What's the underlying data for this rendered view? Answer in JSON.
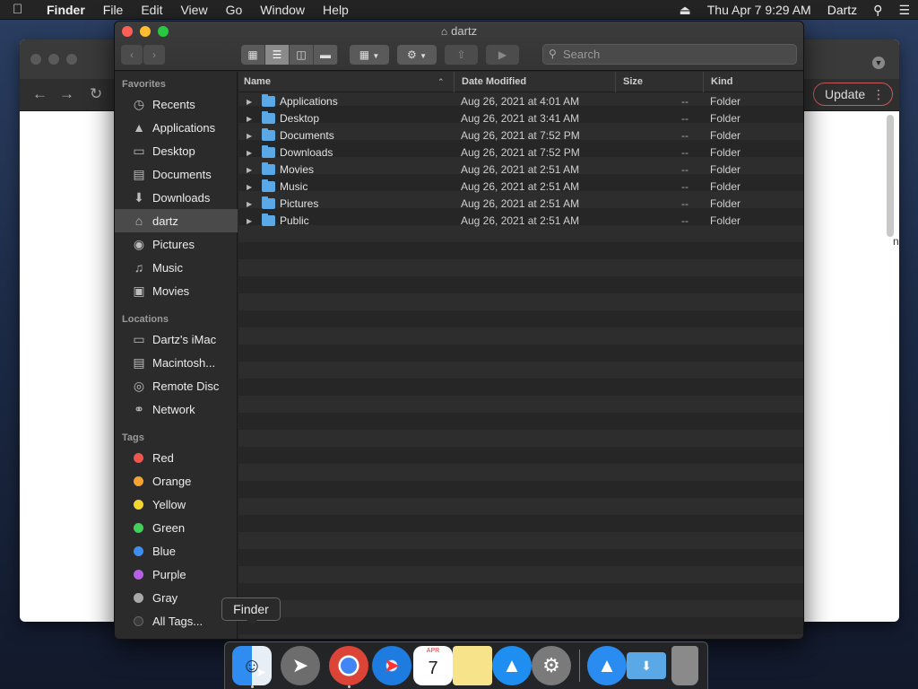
{
  "menubar": {
    "apple_icon": "apple-icon",
    "app_name": "Finder",
    "menus": [
      "File",
      "Edit",
      "View",
      "Go",
      "Window",
      "Help"
    ],
    "datetime": "Thu Apr 7  9:29 AM",
    "user": "Dartz"
  },
  "browser": {
    "update_label": "Update",
    "edge_text": "n"
  },
  "finder": {
    "title": "dartz",
    "search_placeholder": "Search",
    "sidebar": {
      "favorites_heading": "Favorites",
      "favorites": [
        {
          "label": "Recents",
          "icon": "clock-icon"
        },
        {
          "label": "Applications",
          "icon": "applications-icon"
        },
        {
          "label": "Desktop",
          "icon": "desktop-icon"
        },
        {
          "label": "Documents",
          "icon": "documents-icon"
        },
        {
          "label": "Downloads",
          "icon": "downloads-icon"
        },
        {
          "label": "dartz",
          "icon": "home-icon"
        },
        {
          "label": "Pictures",
          "icon": "camera-icon"
        },
        {
          "label": "Music",
          "icon": "music-icon"
        },
        {
          "label": "Movies",
          "icon": "film-icon"
        }
      ],
      "locations_heading": "Locations",
      "locations": [
        {
          "label": "Dartz's iMac",
          "icon": "imac-icon"
        },
        {
          "label": "Macintosh...",
          "icon": "disk-icon"
        },
        {
          "label": "Remote Disc",
          "icon": "disc-icon"
        },
        {
          "label": "Network",
          "icon": "globe-icon"
        }
      ],
      "tags_heading": "Tags",
      "tags": [
        {
          "label": "Red",
          "color": "#f2544e"
        },
        {
          "label": "Orange",
          "color": "#f6a230"
        },
        {
          "label": "Yellow",
          "color": "#f4d530"
        },
        {
          "label": "Green",
          "color": "#41d058"
        },
        {
          "label": "Blue",
          "color": "#3c8ef0"
        },
        {
          "label": "Purple",
          "color": "#b95ee6"
        },
        {
          "label": "Gray",
          "color": "#a9a9a9"
        },
        {
          "label": "All Tags...",
          "color": "#3a3a3a"
        }
      ]
    },
    "columns": {
      "name": "Name",
      "date": "Date Modified",
      "size": "Size",
      "kind": "Kind"
    },
    "rows": [
      {
        "name": "Applications",
        "date": "Aug 26, 2021 at 4:01 AM",
        "size": "--",
        "kind": "Folder"
      },
      {
        "name": "Desktop",
        "date": "Aug 26, 2021 at 3:41 AM",
        "size": "--",
        "kind": "Folder"
      },
      {
        "name": "Documents",
        "date": "Aug 26, 2021 at 7:52 PM",
        "size": "--",
        "kind": "Folder"
      },
      {
        "name": "Downloads",
        "date": "Aug 26, 2021 at 7:52 PM",
        "size": "--",
        "kind": "Folder"
      },
      {
        "name": "Movies",
        "date": "Aug 26, 2021 at 2:51 AM",
        "size": "--",
        "kind": "Folder"
      },
      {
        "name": "Music",
        "date": "Aug 26, 2021 at 2:51 AM",
        "size": "--",
        "kind": "Folder"
      },
      {
        "name": "Pictures",
        "date": "Aug 26, 2021 at 2:51 AM",
        "size": "--",
        "kind": "Folder"
      },
      {
        "name": "Public",
        "date": "Aug 26, 2021 at 2:51 AM",
        "size": "--",
        "kind": "Folder"
      }
    ]
  },
  "tooltip": "Finder",
  "dock": {
    "calendar_month": "APR",
    "calendar_day": "7"
  }
}
